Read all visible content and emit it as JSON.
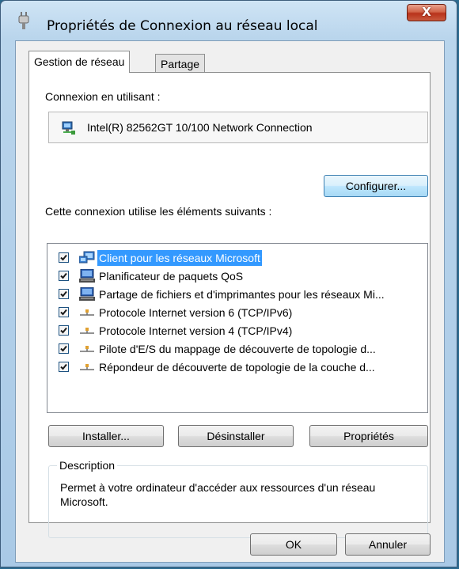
{
  "window": {
    "title": "Propriétés de Connexion au réseau local",
    "close_label": "X"
  },
  "tabs": [
    {
      "label": "Gestion de réseau",
      "active": true
    },
    {
      "label": "Partage",
      "active": false
    }
  ],
  "connection": {
    "label": "Connexion en utilisant :",
    "adapter": "Intel(R) 82562GT 10/100 Network Connection",
    "adapter_icon": "network-adapter-icon",
    "configure_label": "Configurer..."
  },
  "components": {
    "label": "Cette connexion utilise les éléments suivants :",
    "items": [
      {
        "label": "Client pour les réseaux Microsoft",
        "checked": true,
        "icon": "network-client-icon",
        "selected": true
      },
      {
        "label": "Planificateur de paquets QoS",
        "checked": true,
        "icon": "network-service-icon",
        "selected": false
      },
      {
        "label": "Partage de fichiers et d'imprimantes pour les réseaux Mi...",
        "checked": true,
        "icon": "network-service-icon",
        "selected": false
      },
      {
        "label": "Protocole Internet version 6 (TCP/IPv6)",
        "checked": true,
        "icon": "protocol-icon",
        "selected": false
      },
      {
        "label": "Protocole Internet version 4 (TCP/IPv4)",
        "checked": true,
        "icon": "protocol-icon",
        "selected": false
      },
      {
        "label": "Pilote d'E/S du mappage de découverte de topologie d...",
        "checked": true,
        "icon": "protocol-icon",
        "selected": false
      },
      {
        "label": "Répondeur de découverte de topologie de la couche d...",
        "checked": true,
        "icon": "protocol-icon",
        "selected": false
      }
    ]
  },
  "actions": {
    "install": "Installer...",
    "uninstall": "Désinstaller",
    "properties": "Propriétés"
  },
  "description": {
    "legend": "Description",
    "text": "Permet à votre ordinateur d'accéder aux ressources d'un réseau Microsoft."
  },
  "footer": {
    "ok": "OK",
    "cancel": "Annuler"
  },
  "colors": {
    "selection": "#3399ff",
    "close_button": "#c9432a",
    "titlebar": "#cfe4f5"
  }
}
